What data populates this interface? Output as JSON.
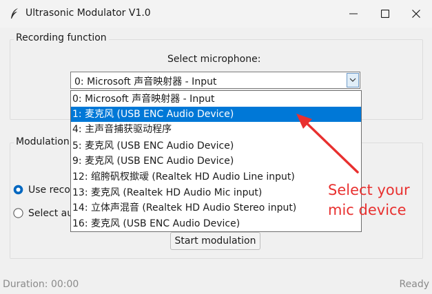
{
  "window": {
    "title": "Ultrasonic Modulator V1.0"
  },
  "recording": {
    "group_title": "Recording function",
    "select_mic_label": "Select microphone:",
    "combo_value": "0: Microsoft 声音映射器 - Input",
    "dropdown_items": [
      "0: Microsoft 声音映射器 - Input",
      "1: 麦克风 (USB ENC Audio Device)",
      "4: 主声音捕获驱动程序",
      "5: 麦克风 (USB ENC Audio Device)",
      "9: 麦克风 (USB ENC Audio Device)",
      "12: 绾胯矾杈撳叆 (Realtek HD Audio Line input)",
      "13: 麦克风 (Realtek HD Audio Mic input)",
      "14: 立体声混音 (Realtek HD Audio Stereo input)",
      "16: 麦克风 (USB ENC Audio Device)"
    ],
    "selected_index": 1
  },
  "modulation": {
    "group_title": "Modulation",
    "radio_use_recording": "Use reco",
    "radio_select_audio": "Select au",
    "start_button": "Start modulation"
  },
  "status": {
    "duration": "Duration: 00:00",
    "state": "Ready"
  },
  "annotation": {
    "line1": "Select your",
    "line2": "mic device",
    "color": "#e8302f"
  },
  "colors": {
    "selection": "#0078d7",
    "radio_accent": "#0067c0"
  }
}
